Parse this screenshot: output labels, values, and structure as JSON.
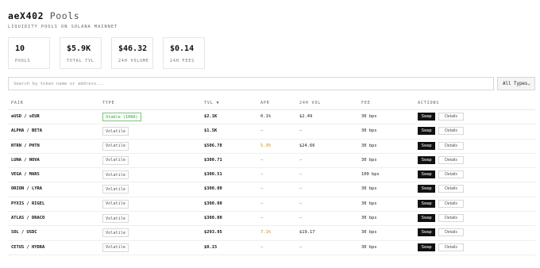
{
  "header": {
    "brand": "aeX402",
    "title_rest": "Pools",
    "subtitle": "LIQUIDITY POOLS ON SOLANA MAINNET"
  },
  "stats": [
    {
      "value": "10",
      "label": "POOLS"
    },
    {
      "value": "$5.9K",
      "label": "TOTAL TVL"
    },
    {
      "value": "$46.32",
      "label": "24H VOLUME"
    },
    {
      "value": "$0.14",
      "label": "24H FEES"
    }
  ],
  "search": {
    "placeholder": "Search by token name or address...",
    "value": ""
  },
  "filter": {
    "selected": "All Types"
  },
  "table": {
    "headers": {
      "pair": "PAIR",
      "type": "TYPE",
      "tvl": "TVL ▼",
      "apr": "APR",
      "vol": "24H VOL",
      "fee": "FEE",
      "actions": "ACTIONS"
    },
    "swap_label": "Swap",
    "details_label": "Details",
    "rows": [
      {
        "pair": "eUSD / sEUR",
        "type": "Stable (100A)",
        "stable": true,
        "tvl": "$2.1K",
        "apr": "0.1%",
        "apr_pos": false,
        "vol": "$2.49",
        "fee": "30 bps"
      },
      {
        "pair": "ALPHA / BETA",
        "type": "Volatile",
        "stable": false,
        "tvl": "$1.5K",
        "apr": "—",
        "apr_pos": false,
        "vol": "—",
        "fee": "30 bps"
      },
      {
        "pair": "NTRN / PHTN",
        "type": "Volatile",
        "stable": false,
        "tvl": "$506.78",
        "apr": "5.3%",
        "apr_pos": true,
        "vol": "$24.66",
        "fee": "30 bps"
      },
      {
        "pair": "LUNA / NOVA",
        "type": "Volatile",
        "stable": false,
        "tvl": "$300.71",
        "apr": "—",
        "apr_pos": false,
        "vol": "—",
        "fee": "30 bps"
      },
      {
        "pair": "VEGA / MARS",
        "type": "Volatile",
        "stable": false,
        "tvl": "$300.51",
        "apr": "—",
        "apr_pos": false,
        "vol": "—",
        "fee": "100 bps"
      },
      {
        "pair": "ORION / LYRA",
        "type": "Volatile",
        "stable": false,
        "tvl": "$300.00",
        "apr": "—",
        "apr_pos": false,
        "vol": "—",
        "fee": "30 bps"
      },
      {
        "pair": "PYXIS / RIGEL",
        "type": "Volatile",
        "stable": false,
        "tvl": "$300.00",
        "apr": "—",
        "apr_pos": false,
        "vol": "—",
        "fee": "30 bps"
      },
      {
        "pair": "ATLAS / DRACO",
        "type": "Volatile",
        "stable": false,
        "tvl": "$300.00",
        "apr": "—",
        "apr_pos": false,
        "vol": "—",
        "fee": "30 bps"
      },
      {
        "pair": "SOL / USDC",
        "type": "Volatile",
        "stable": false,
        "tvl": "$293.95",
        "apr": "7.1%",
        "apr_pos": true,
        "vol": "$19.17",
        "fee": "30 bps"
      },
      {
        "pair": "CETUS / HYDRA",
        "type": "Volatile",
        "stable": false,
        "tvl": "$0.15",
        "apr": "—",
        "apr_pos": false,
        "vol": "—",
        "fee": "30 bps"
      }
    ]
  }
}
